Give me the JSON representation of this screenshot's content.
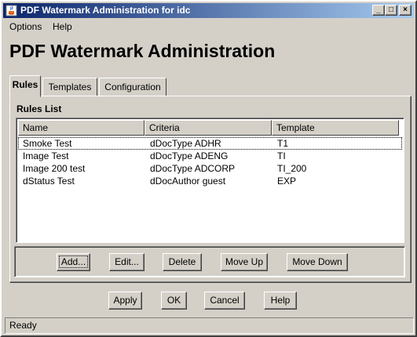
{
  "window": {
    "title": "PDF Watermark Administration for idc",
    "minimize_glyph": "_",
    "maximize_glyph": "□",
    "close_glyph": "×"
  },
  "menu": {
    "items": [
      "Options",
      "Help"
    ]
  },
  "page_title": "PDF Watermark Administration",
  "tabs": [
    {
      "label": "Rules",
      "active": true
    },
    {
      "label": "Templates",
      "active": false
    },
    {
      "label": "Configuration",
      "active": false
    }
  ],
  "rules": {
    "section_label": "Rules List",
    "columns": [
      "Name",
      "Criteria",
      "Template"
    ],
    "rows": [
      {
        "name": "Smoke Test",
        "criteria": "dDocType ADHR",
        "template": "T1",
        "selected": true
      },
      {
        "name": "Image Test",
        "criteria": "dDocType ADENG",
        "template": "TI",
        "selected": false
      },
      {
        "name": "Image 200 test",
        "criteria": "dDocType ADCORP",
        "template": "TI_200",
        "selected": false
      },
      {
        "name": "dStatus Test",
        "criteria": "dDocAuthor guest",
        "template": "EXP",
        "selected": false
      }
    ],
    "buttons": {
      "add": "Add...",
      "edit": "Edit...",
      "delete": "Delete",
      "move_up": "Move Up",
      "move_down": "Move Down"
    }
  },
  "dialog_buttons": {
    "apply": "Apply",
    "ok": "OK",
    "cancel": "Cancel",
    "help": "Help"
  },
  "status": "Ready",
  "colors": {
    "title_gradient_start": "#0a246a",
    "title_gradient_end": "#a6caf0",
    "face": "#d4d0c8"
  }
}
